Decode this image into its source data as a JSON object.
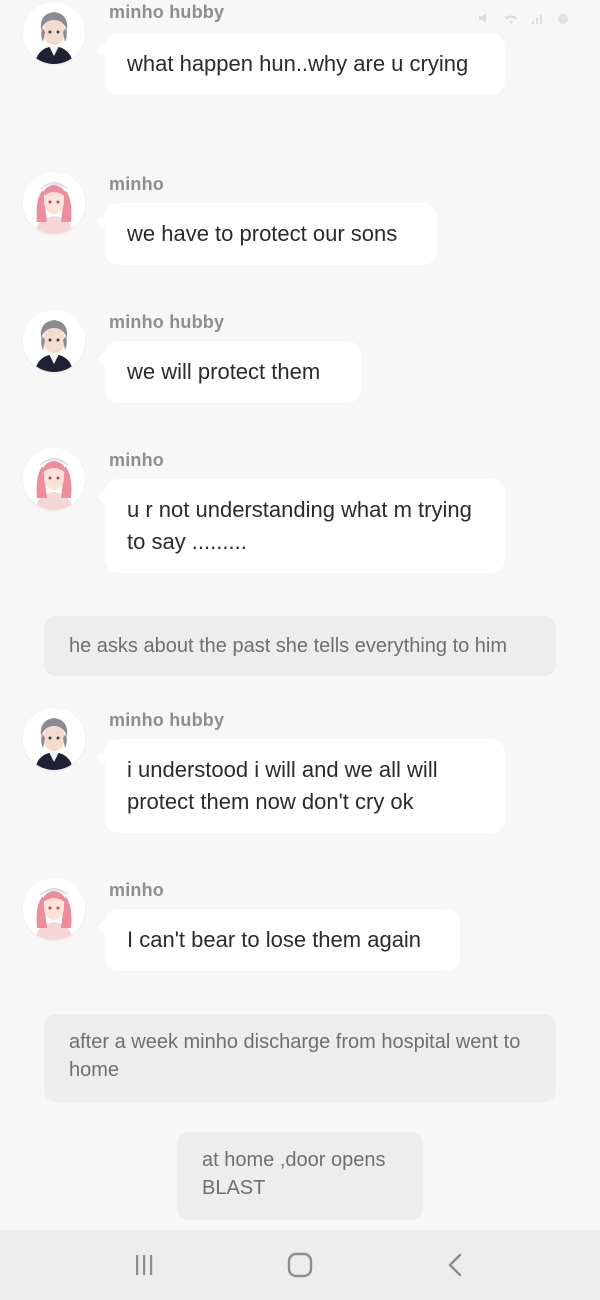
{
  "status_bar": {
    "icons": [
      "mute-icon",
      "wifi-icon",
      "signal-icon",
      "battery-icon"
    ]
  },
  "chat": {
    "messages": [
      {
        "kind": "char",
        "sender": "minho hubby",
        "avatar": "male-character-avatar",
        "text": "what happen hun..why are u crying"
      },
      {
        "kind": "char",
        "sender": "minho",
        "avatar": "female-character-avatar",
        "text": "we have to protect our sons"
      },
      {
        "kind": "char",
        "sender": "minho hubby",
        "avatar": "male-character-avatar",
        "text": "we will protect them"
      },
      {
        "kind": "char",
        "sender": "minho",
        "avatar": "female-character-avatar",
        "text": "u r not understanding what m trying to say ........."
      },
      {
        "kind": "narration",
        "text": "he asks about the past she tells everything to him"
      },
      {
        "kind": "char",
        "sender": "minho hubby",
        "avatar": "male-character-avatar",
        "text": "i understood i will and we all will protect them now don't cry ok"
      },
      {
        "kind": "char",
        "sender": "minho",
        "avatar": "female-character-avatar",
        "text": "I can't bear to lose them again"
      },
      {
        "kind": "narration",
        "text": "after  a week minho discharge from hospital went to home"
      },
      {
        "kind": "narration",
        "text": "at home ,door opens BLAST"
      }
    ]
  },
  "nav_bar": {
    "buttons": [
      "recent-apps-icon",
      "home-icon",
      "back-icon"
    ]
  },
  "colors": {
    "background": "#f7f7f7",
    "bubble": "#ffffff",
    "narration": "#ededed",
    "sender_text": "#8e8e8e",
    "message_text": "#2b2b2b",
    "nav_bar": "#ececec"
  }
}
